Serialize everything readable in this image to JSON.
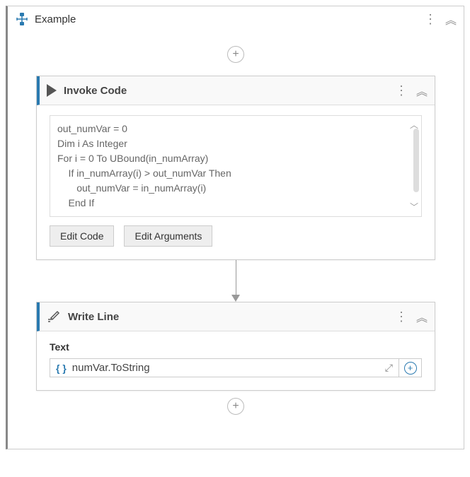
{
  "sequence": {
    "title": "Example",
    "kebab": "⋮",
    "collapse": "︽"
  },
  "add_button": "+",
  "invoke": {
    "title": "Invoke Code",
    "kebab": "⋮",
    "collapse": "︽",
    "code_lines": {
      "l0": "out_numVar = 0",
      "l1": "Dim i As Integer",
      "l2": "For i = 0 To UBound(in_numArray)",
      "l3": "    If in_numArray(i) > out_numVar Then",
      "l4": "       out_numVar = in_numArray(i)",
      "l5": "    End If"
    },
    "scroll_up": "︿",
    "scroll_down": "﹀",
    "edit_code": "Edit Code",
    "edit_args": "Edit Arguments"
  },
  "writeline": {
    "title": "Write Line",
    "kebab": "⋮",
    "collapse": "︽",
    "prop_label": "Text",
    "brace": "{ }",
    "expression": "numVar.ToString",
    "expand": "⤢",
    "plus": "+"
  }
}
